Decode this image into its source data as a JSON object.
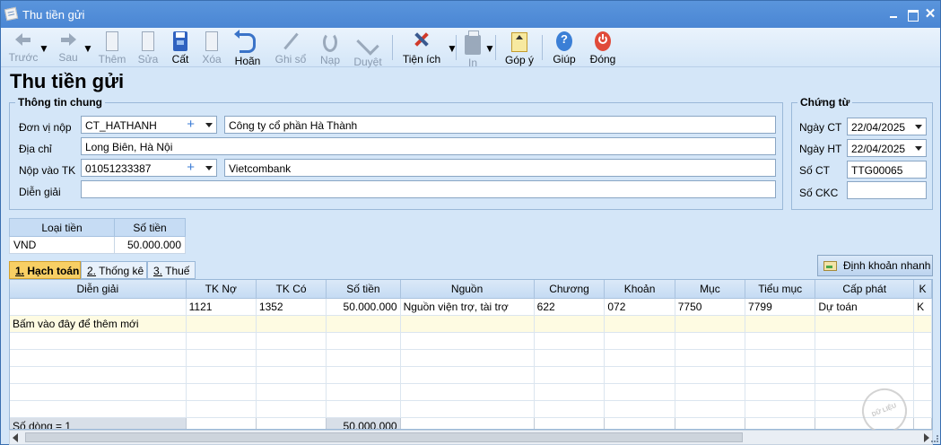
{
  "window": {
    "title": "Thu tiền gửi"
  },
  "toolbar": {
    "prev": "Trước",
    "next": "Sau",
    "add": "Thêm",
    "edit": "Sửa",
    "save": "Cất",
    "delete": "Xóa",
    "undo": "Hoãn",
    "post": "Ghi sổ",
    "reload": "Nạp",
    "approve": "Duyệt",
    "utilities": "Tiện ích",
    "print": "In",
    "feedback": "Góp ý",
    "help": "Giúp",
    "close": "Đóng"
  },
  "form": {
    "title": "Thu tiền gửi",
    "general_info": {
      "legend": "Thông tin chung",
      "payer_label": "Đơn vị nộp",
      "payer_code": "CT_HATHANH",
      "payer_name": "Công ty cổ phần Hà Thành",
      "address_label": "Địa chỉ",
      "address": "Long Biên, Hà Nội",
      "account_label": "Nộp vào TK",
      "account_no": "01051233387",
      "bank_name": "Vietcombank",
      "description_label": "Diễn giải",
      "description": ""
    },
    "voucher": {
      "legend": "Chứng từ",
      "voucher_date_label": "Ngày CT",
      "voucher_date": "22/04/2025",
      "posting_date_label": "Ngày HT",
      "posting_date": "22/04/2025",
      "voucher_no_label": "Số CT",
      "voucher_no": "TTG00065",
      "ckc_label": "Số CKC",
      "ckc": ""
    }
  },
  "currency_table": {
    "headers": [
      "Loại tiền",
      "Số tiền"
    ],
    "row": [
      "VND",
      "50.000.000"
    ]
  },
  "tabs": [
    {
      "key": "1.",
      "label": " Hạch toán"
    },
    {
      "key": "2.",
      "label": " Thống kê"
    },
    {
      "key": "3.",
      "label": " Thuế"
    }
  ],
  "quick_entry_label": "Định khoản nhanh",
  "grid": {
    "headers": [
      "Diễn giải",
      "TK Nợ",
      "TK Có",
      "Số tiền",
      "Nguồn",
      "Chương",
      "Khoản",
      "Mục",
      "Tiểu mục",
      "Cấp phát",
      "K"
    ],
    "rows": [
      [
        "",
        "1121",
        "1352",
        "50.000.000",
        "Nguồn viện trợ, tài trợ",
        "622",
        "072",
        "7750",
        "7799",
        "Dự toán",
        "K"
      ]
    ],
    "add_row_text": "Bấm vào đây để thêm mới",
    "footer_count": "Số dòng = 1",
    "footer_total": "50.000.000"
  },
  "watermark": "DỮ LIỆU MẪU"
}
